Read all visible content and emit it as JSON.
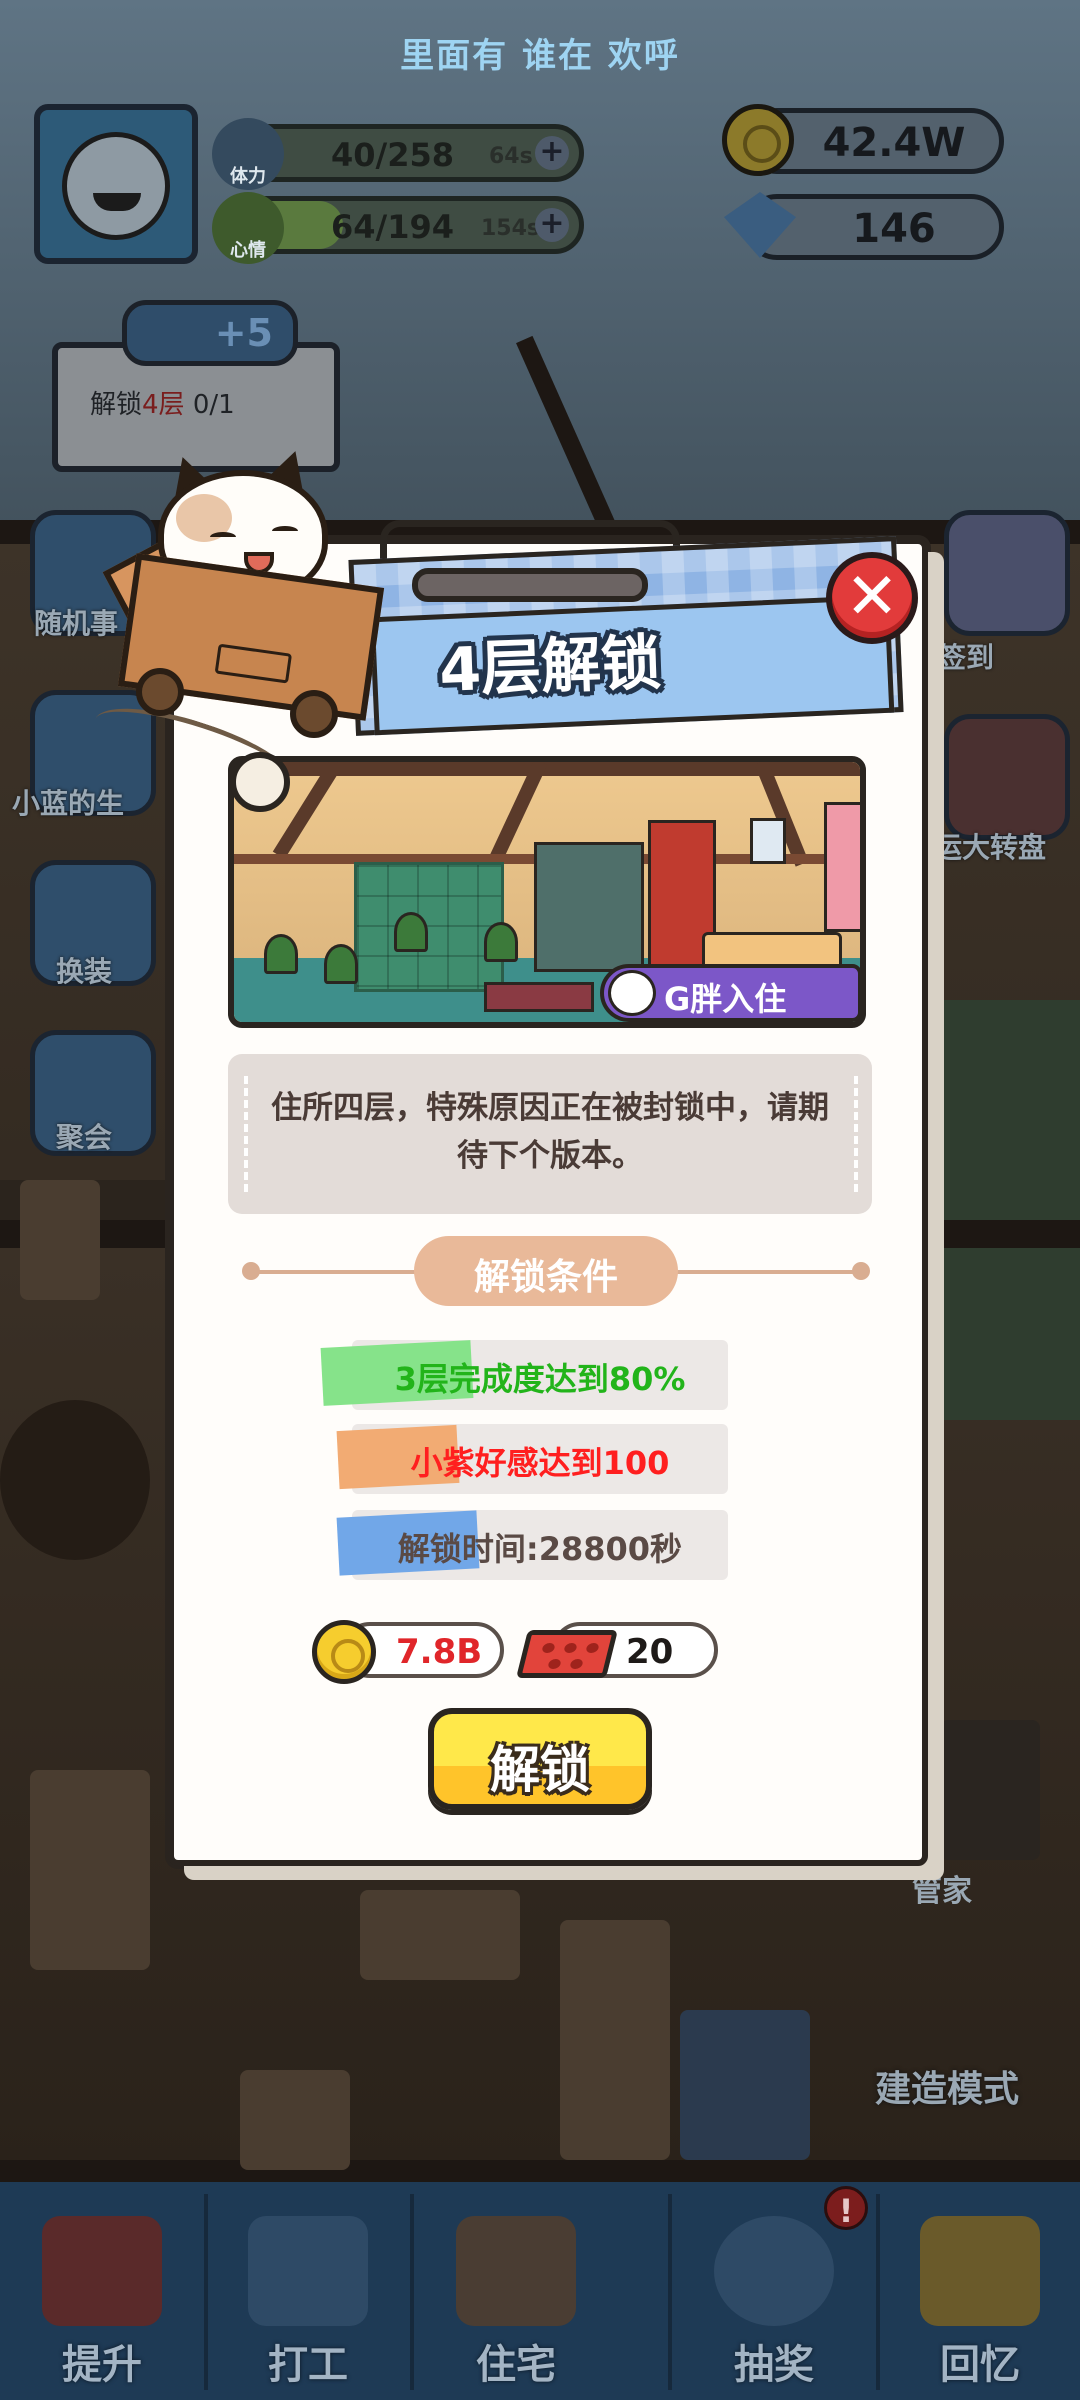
{
  "header": {
    "title": "里面有 谁在 欢呼"
  },
  "stats": {
    "stamina": {
      "label": "体力",
      "value": "40/258",
      "timer": "64s",
      "fill": 0.155
    },
    "mood": {
      "label": "心情",
      "value": "64/194",
      "timer": "154s",
      "fill": 0.33
    }
  },
  "resources": {
    "coins": "42.4W",
    "gems": "146"
  },
  "quest": {
    "bonus": "+5",
    "text_prefix": "解锁",
    "text_highlight": "4层",
    "text_progress": " 0/1"
  },
  "side_left": [
    "随机事",
    "小蓝的生",
    "换装",
    "聚会"
  ],
  "side_right": [
    "签到",
    "运大转盘"
  ],
  "scene_labels": {
    "steward": "管家",
    "build_mode": "建造模式"
  },
  "modal": {
    "title": "4层解锁",
    "close_symbol": "✕",
    "resident_tag": "G胖入住",
    "description": "住所四层，特殊原因正在被封锁中，请期待下个版本。",
    "conditions_title": "解锁条件",
    "conditions": [
      {
        "text": "3层完成度达到80%",
        "color": "#22b41a",
        "brush": "#7fe07a"
      },
      {
        "text": "小紫好感达到100",
        "color": "#ff1f1f",
        "brush": "#f2a86a"
      },
      {
        "text": "解锁时间:28800秒",
        "color": "#5a4a45",
        "brush": "#6ea4e6"
      }
    ],
    "cost": {
      "coins": "7.8B",
      "bricks": "20"
    },
    "unlock_button": "解锁"
  },
  "nav": [
    "提升",
    "打工",
    "住宅",
    "抽奖",
    "回忆"
  ],
  "nav_alert": "!",
  "colors": {
    "coin_cost": "#e0262a",
    "title_blue": "#9cc6f0",
    "close_red": "#e23b3b"
  }
}
